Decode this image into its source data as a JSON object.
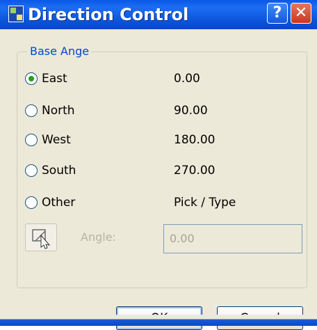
{
  "window": {
    "title": "Direction Control",
    "help_label": "?",
    "close_label": "✕"
  },
  "base_angle": {
    "group_label": "Base Ange",
    "selected": "east",
    "options": [
      {
        "id": "east",
        "label": "East",
        "value": "0.00"
      },
      {
        "id": "north",
        "label": "North",
        "value": "90.00"
      },
      {
        "id": "west",
        "label": "West",
        "value": "180.00"
      },
      {
        "id": "south",
        "label": "South",
        "value": "270.00"
      },
      {
        "id": "other",
        "label": "Other",
        "value": "Pick / Type"
      }
    ]
  },
  "angle": {
    "label": "Angle:",
    "value": "0.00",
    "pick_icon": "pick-angle-icon"
  },
  "buttons": {
    "ok": "OK",
    "cancel": "Cancel"
  },
  "colors": {
    "titlebar": "#0a58e6",
    "group_label": "#0046d5",
    "radio_selected": "#21a121",
    "close_button": "#c6391c"
  }
}
